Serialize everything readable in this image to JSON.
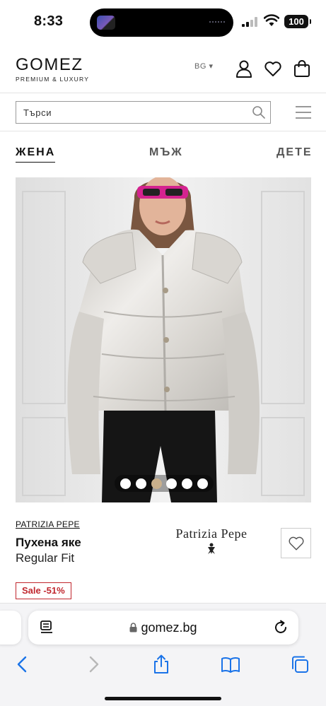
{
  "status_bar": {
    "time": "8:33",
    "battery": "100"
  },
  "header": {
    "logo": "GOMEZ",
    "logo_tagline": "PREMIUM & LUXURY",
    "language": "BG ▾",
    "icons": [
      "user-icon",
      "heart-icon",
      "bag-icon"
    ]
  },
  "search": {
    "placeholder": "Търси"
  },
  "tabs": [
    {
      "label": "ЖЕНА",
      "active": true
    },
    {
      "label": "МЪЖ",
      "active": false
    },
    {
      "label": "ДЕТЕ",
      "active": false
    }
  ],
  "gallery": {
    "total_images": 6,
    "active_index": 2
  },
  "product": {
    "brand": "PATRIZIA PEPE",
    "name": "Пухена яке",
    "fit": "Regular Fit",
    "brand_logo_text": "Patrizia Pepe",
    "sale_badge": "Sale -51%"
  },
  "browser": {
    "url": "gomez.bg"
  },
  "colors": {
    "accent_sale": "#c0262d",
    "active_dot": "#c9b08c",
    "text": "#111111"
  }
}
